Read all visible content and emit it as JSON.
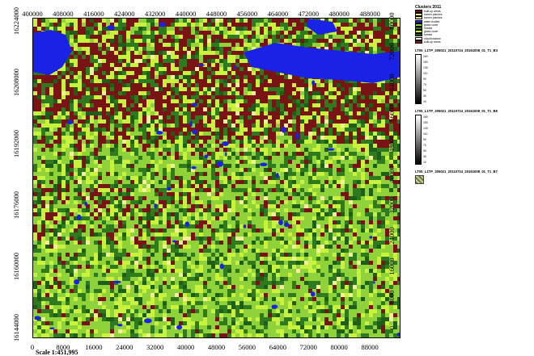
{
  "map": {
    "x_ticks_top": [
      "400000",
      "408000",
      "416000",
      "424000",
      "432000",
      "440000",
      "448000",
      "456000",
      "464000",
      "472000",
      "480000",
      "488000"
    ],
    "x_ticks_bottom": [
      "0",
      "8000",
      "16000",
      "24000",
      "32000",
      "40000",
      "48000",
      "56000",
      "64000",
      "72000",
      "80000",
      "88000"
    ],
    "y_ticks_left": [
      "16224000",
      "16208000",
      "16192000",
      "16176000",
      "16160000",
      "16144000"
    ],
    "y_ticks_right": [
      "80000",
      "72000",
      "64000",
      "56000",
      "48000",
      "40000",
      "32000",
      "24000",
      "16000",
      "8000",
      "0"
    ],
    "scale_text": "Scale 1:451,995",
    "colors": {
      "grass": "#8fd23a",
      "bright_grass": "#c8f23c",
      "forest": "#2f7a1e",
      "dark_forest": "#1f5e16",
      "builtup": "#7a1414",
      "water": "#1a22e6",
      "bare": "#f3ef9a"
    }
  },
  "legend": {
    "classes_title": "Clusters 2011",
    "classes": [
      {
        "label": "built-up areas",
        "color": "#7a1414"
      },
      {
        "label": "barren patches",
        "color": "#f3ef9a"
      },
      {
        "label": "barren patches",
        "color": "#e8e070"
      },
      {
        "label": "water bodies",
        "color": "#1a22e6"
      },
      {
        "label": "grass cover",
        "color": "#8fd23a"
      },
      {
        "label": "forests",
        "color": "#2f7a1e"
      },
      {
        "label": "grass cover",
        "color": "#c8f23c"
      },
      {
        "label": "forests",
        "color": "#1f5e16"
      },
      {
        "label": "cloud/shadow",
        "color": "#ffffff"
      },
      {
        "label": "built-up areas",
        "color": "#8a1a1a"
      }
    ],
    "layer_b3": {
      "title": "LT05_L1TP_205021_20110724_20161008_01_T1_B3",
      "labels": [
        "160",
        "150",
        "130",
        "110",
        "90",
        "70",
        "50",
        "30",
        "10"
      ]
    },
    "layer_b5": {
      "title": "LT05_L1TP_205021_20110724_20161008_01_T1_B5",
      "labels": [
        "160",
        "150",
        "130",
        "110",
        "90",
        "70",
        "50",
        "30",
        "10"
      ]
    },
    "layer_b7": {
      "title": "LT05_L1TP_205021_20110724_20161008_01_T1_B7"
    }
  }
}
